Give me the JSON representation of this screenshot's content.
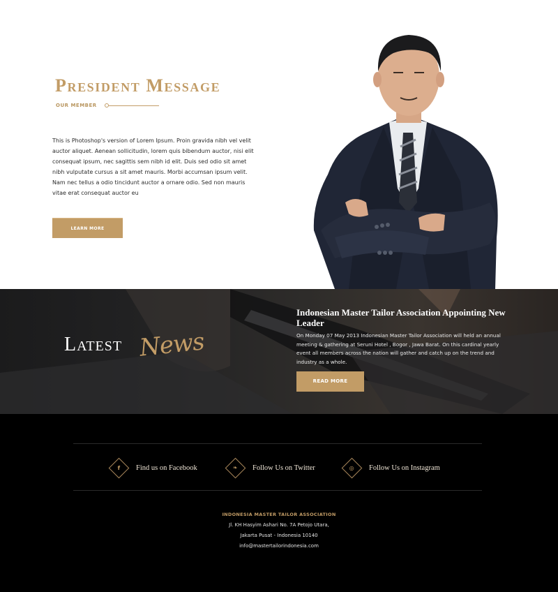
{
  "president": {
    "title": "President Message",
    "subtitle": "OUR MEMBER",
    "body": "This is Photoshop's version  of Lorem Ipsum. Proin gravida nibh vel velit auctor aliquet. Aenean sollicitudin, lorem quis bibendum auctor, nisi elit consequat ipsum, nec sagittis sem nibh id elit. Duis sed odio sit amet nibh vulputate cursus a sit amet mauris. Morbi accumsan ipsum velit. Nam nec tellus a odio tincidunt auctor a ornare odio. Sed non  mauris vitae erat consequat auctor eu",
    "button_label": "LEARN MORE"
  },
  "news": {
    "heading_main": "Latest",
    "heading_script": "News",
    "title": "Indonesian Master Tailor Association Appointing New Leader",
    "text": "On Monday 07 May 2013 Indonesian Master Tailor Association will held an annual meeting & gathering at Seruni Hotel , Bogor , Jawa Barat. On this cardinal yearly event all members across the nation will gather and catch up on the trend and industry as a whole.",
    "button_label": "READ MORE"
  },
  "footer": {
    "social": [
      {
        "label": "Find us on Facebook",
        "icon": "facebook-icon",
        "glyph": "f"
      },
      {
        "label": "Follow Us on Twitter",
        "icon": "twitter-icon",
        "glyph": "❧"
      },
      {
        "label": "Follow Us on Instagram",
        "icon": "instagram-icon",
        "glyph": "◎"
      }
    ],
    "association": "INDONESIA MASTER TAILOR ASSOCIATION",
    "address_line1": "Jl. KH Hasyim Ashari No. 7A Petojo Utara,",
    "address_line2": "Jakarta Pusat - Indonesia 10140",
    "email": "info@mastertailorindonesia.com"
  },
  "colors": {
    "accent_gold": "#c29c66",
    "dark_band": "#232324",
    "footer_bg": "#000000"
  }
}
